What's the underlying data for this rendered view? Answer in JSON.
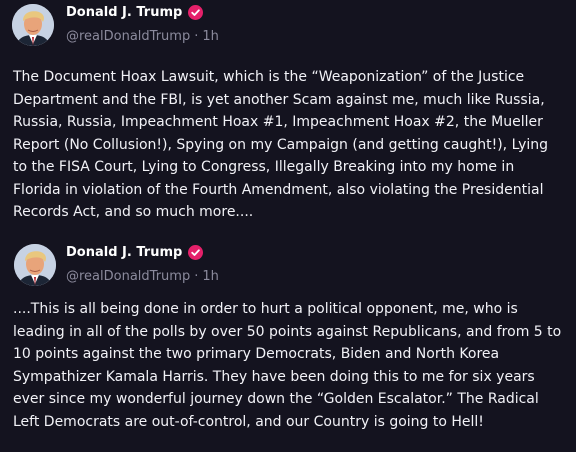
{
  "posts": [
    {
      "author": {
        "display_name": "Donald J. Trump",
        "handle": "@realDonaldTrump",
        "verified": true,
        "avatar_icon": "avatar-photo"
      },
      "separator": "·",
      "timestamp": "1h",
      "body_lines": [
        "The Document Hoax Lawsuit, which is the “Weaponization” of the Justice",
        "Department and the FBI, is yet another Scam against me, much like Russia,",
        "Russia, Russia, Impeachment Hoax #1, Impeachment Hoax #2, the Mueller",
        "Report (No Collusion!), Spying on my Campaign (and getting caught!), Lying",
        "to the FISA Court, Lying to Congress, Illegally Breaking into my home in",
        "Florida in violation of the Fourth Amendment, also violating the Presidential",
        "Records Act, and so much more...."
      ]
    },
    {
      "author": {
        "display_name": "Donald J. Trump",
        "handle": "@realDonaldTrump",
        "verified": true,
        "avatar_icon": "avatar-photo"
      },
      "separator": "·",
      "timestamp": "1h",
      "body_lines": [
        "....This is all being done in order to hurt a political opponent, me, who is",
        "leading in all of the polls by over 50 points against Republicans, and from 5 to",
        "10 points against the two primary Democrats, Biden and North Korea",
        "Sympathizer Kamala Harris. They have been doing this to me for six years",
        "ever since my wonderful journey down the “Golden Escalator.” The Radical",
        "Left Democrats are out-of-control, and our Country is going to Hell!"
      ]
    }
  ],
  "colors": {
    "background": "#14131f",
    "text": "#f2f2f7",
    "muted": "#8b8a9c",
    "verified_badge": "#e5206a"
  }
}
